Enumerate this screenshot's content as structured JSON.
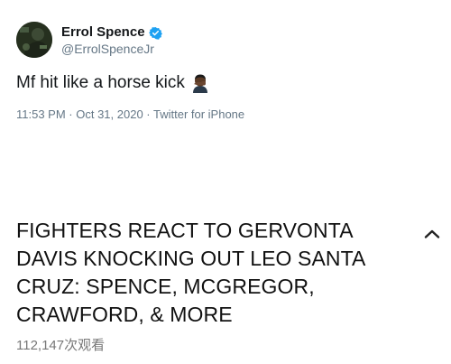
{
  "tweet": {
    "author": {
      "display_name": "Errol Spence",
      "handle": "@ErrolSpenceJr",
      "verified": true
    },
    "text": "Mf hit like a horse kick",
    "emoji": "man-facepalming-emoji",
    "timestamp": "11:53 PM · Oct 31, 2020 · Twitter for iPhone",
    "colors": {
      "verified_badge": "#1da1f2",
      "secondary_text": "#657786"
    }
  },
  "article": {
    "headline": "FIGHTERS REACT TO GERVONTA DAVIS KNOCKING OUT LEO SANTA CRUZ: SPENCE, MCGREGOR, CRAWFORD, & MORE",
    "views": "112,147次观看",
    "collapse_icon": "chevron-up-icon"
  }
}
